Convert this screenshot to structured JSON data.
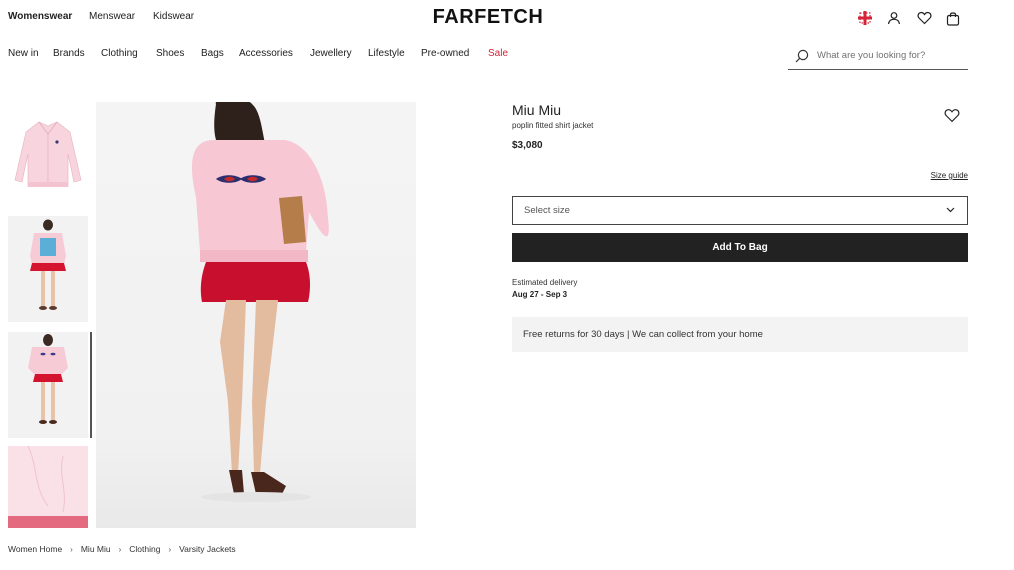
{
  "header": {
    "genders": [
      {
        "label": "Womenswear",
        "active": true
      },
      {
        "label": "Menswear",
        "active": false
      },
      {
        "label": "Kidswear",
        "active": false
      }
    ],
    "logo": "FARFETCH",
    "icons": [
      "region-flag-icon",
      "account-icon",
      "wishlist-icon",
      "bag-icon"
    ]
  },
  "nav": {
    "items": [
      "New in",
      "Brands",
      "Clothing",
      "Shoes",
      "Bags",
      "Accessories",
      "Jewellery",
      "Lifestyle",
      "Pre-owned",
      "Sale"
    ],
    "search_placeholder": "What are you looking for?"
  },
  "gallery": {
    "thumbnails": [
      "jacket-front",
      "model-front",
      "model-back",
      "jacket-detail"
    ],
    "selected_index": 2
  },
  "product": {
    "brand": "Miu Miu",
    "description": "poplin fitted shirt jacket",
    "price": "$3,080",
    "size_guide": "Size guide",
    "size_placeholder": "Select size",
    "add_to_bag": "Add To Bag",
    "delivery_label": "Estimated delivery",
    "delivery_dates": "Aug 27 - Sep 3",
    "returns": "Free returns for 30 days | We can collect from your home"
  },
  "breadcrumb": [
    "Women Home",
    "Miu Miu",
    "Clothing",
    "Varsity Jackets"
  ],
  "colors": {
    "sale": "#d6233a",
    "button": "#222222",
    "panel": "#f3f3f3",
    "jacket": "#f5c6d3",
    "skirt": "#c8102e"
  }
}
